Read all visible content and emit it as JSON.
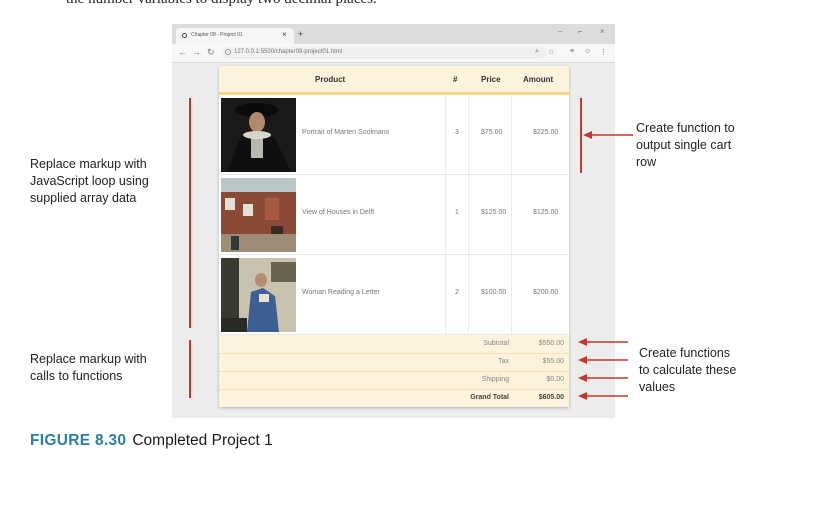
{
  "top_text": "the number variables to display two decimal places.",
  "browser": {
    "tab_title": "Chapter 08 - Project 01",
    "url": "127.0.0.1:5500/chapter08-project01.html"
  },
  "cart": {
    "headers": {
      "product": "Product",
      "qty": "#",
      "price": "Price",
      "amount": "Amount"
    },
    "rows": [
      {
        "name": "Portrait of Marten Soolmans",
        "qty": "3",
        "price": "$75.00",
        "amount": "$225.00"
      },
      {
        "name": "View of Houses in Delft",
        "qty": "1",
        "price": "$125.00",
        "amount": "$125.00"
      },
      {
        "name": "Woman Reading a Letter",
        "qty": "2",
        "price": "$100.00",
        "amount": "$200.00"
      }
    ],
    "summary": {
      "subtotal_label": "Subtotal",
      "subtotal": "$550.00",
      "tax_label": "Tax",
      "tax": "$55.00",
      "shipping_label": "Shipping",
      "shipping": "$0.00",
      "grand_label": "Grand Total",
      "grand": "$605.00"
    }
  },
  "annotations": {
    "left_top": [
      "Replace markup with",
      "JavaScript loop using",
      "supplied array data"
    ],
    "left_bottom": [
      "Replace markup with",
      "calls to functions"
    ],
    "right_top": [
      "Create function to",
      "output single cart",
      "row"
    ],
    "right_bottom": [
      "Create functions",
      "to calculate these",
      "values"
    ]
  },
  "caption": {
    "number": "FIGURE 8.30",
    "text": "Completed Project 1"
  }
}
